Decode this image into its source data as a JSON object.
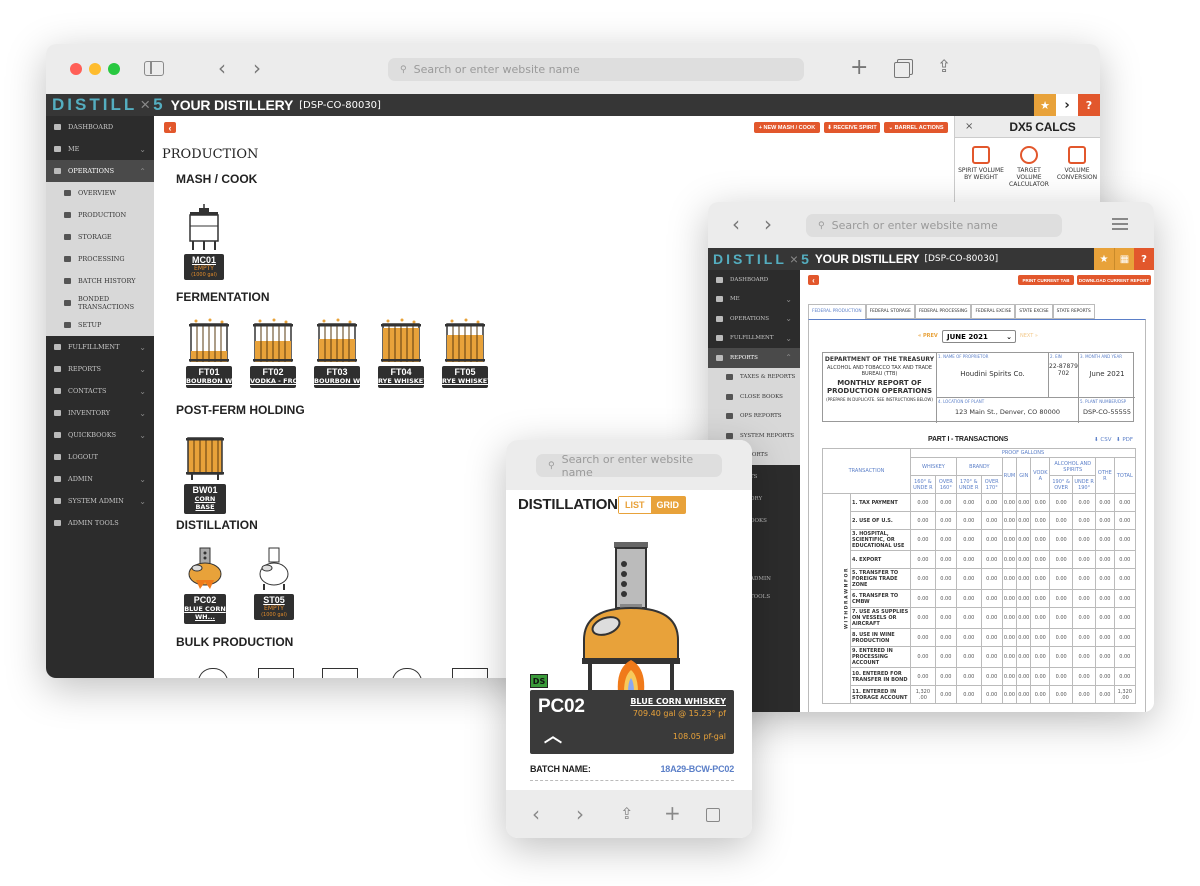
{
  "desktop": {
    "url_placeholder": "Search or enter website name",
    "brand": {
      "logo_left": "DISTILL",
      "logo_x": "×",
      "logo_right": "5",
      "title": "YOUR DISTILLERY",
      "dsp": "[DSP-CO-80030]"
    },
    "sidebar": [
      {
        "label": "DASHBOARD",
        "icon": "dashboard-icon"
      },
      {
        "label": "ME",
        "icon": "user-icon",
        "chev": "⌄"
      },
      {
        "label": "OPERATIONS",
        "icon": "factory-icon",
        "chev": "⌃",
        "active": true
      },
      {
        "label": "OVERVIEW",
        "icon": "binoculars-icon",
        "sub": true
      },
      {
        "label": "PRODUCTION",
        "icon": "production-icon",
        "sub": true
      },
      {
        "label": "STORAGE",
        "icon": "storage-icon",
        "sub": true
      },
      {
        "label": "PROCESSING",
        "icon": "processing-icon",
        "sub": true
      },
      {
        "label": "BATCH HISTORY",
        "icon": "history-icon",
        "sub": true
      },
      {
        "label": "BONDED TRANSACTIONS",
        "icon": "transfer-icon",
        "sub": true
      },
      {
        "label": "SETUP",
        "icon": "wrench-icon",
        "sub": true
      },
      {
        "label": "FULFILLMENT",
        "icon": "fulfillment-icon",
        "chev": "⌄"
      },
      {
        "label": "REPORTS",
        "icon": "chart-icon",
        "chev": "⌄"
      },
      {
        "label": "CONTACTS",
        "icon": "contacts-icon",
        "chev": "⌄"
      },
      {
        "label": "INVENTORY",
        "icon": "inventory-icon",
        "chev": "⌄"
      },
      {
        "label": "QUICKBOOKS",
        "icon": "quickbooks-icon",
        "chev": "⌄"
      },
      {
        "label": "LOGOUT",
        "icon": "logout-icon"
      },
      {
        "label": "ADMIN",
        "icon": "key-icon",
        "chev": "⌄"
      },
      {
        "label": "SYSTEM ADMIN",
        "icon": "filter-icon",
        "chev": "⌄"
      },
      {
        "label": "ADMIN TOOLS",
        "icon": "admin-user-icon"
      }
    ],
    "toolbar": {
      "new_mash": "+ NEW MASH / COOK",
      "receive": "⬇ RECEIVE SPIRIT",
      "barrel": "⌄ BARREL ACTIONS"
    },
    "page_title": "PRODUCTION",
    "sections": {
      "mash": "MASH / COOK",
      "ferm": "FERMENTATION",
      "postferm": "POST-FERM HOLDING",
      "distill": "DISTILLATION",
      "bulk": "BULK PRODUCTION"
    },
    "mash": [
      {
        "code": "MC01",
        "status": "EMPTY",
        "cap": "(1000 gal)"
      }
    ],
    "ferm": [
      {
        "code": "FT01",
        "name": "BOURBON WHI..."
      },
      {
        "code": "FT02",
        "name": "VODKA - FROM ..."
      },
      {
        "code": "FT03",
        "name": "BOURBON WHI..."
      },
      {
        "code": "FT04",
        "name": "RYE WHISKEY"
      },
      {
        "code": "FT05",
        "name": "RYE WHISKEY"
      }
    ],
    "postferm": [
      {
        "code": "BW01",
        "name": "CORN BASE"
      }
    ],
    "distill": [
      {
        "code": "PC02",
        "name": "BLUE CORN WH..."
      },
      {
        "code": "ST05",
        "status": "EMPTY",
        "cap": "(1000 gal)"
      }
    ],
    "calcs": {
      "title": "DX5 CALCS",
      "close": "×",
      "items": [
        "SPIRIT VOLUME BY WEIGHT",
        "TARGET VOLUME CALCULATOR",
        "VOLUME CONVERSION"
      ]
    }
  },
  "tablet": {
    "url_placeholder": "Search or enter website name",
    "brand": {
      "logo_left": "DISTILL",
      "logo_x": "×",
      "logo_right": "5",
      "title": "YOUR DISTILLERY",
      "dsp": "[DSP-CO-80030]"
    },
    "sidebar": [
      {
        "label": "DASHBOARD",
        "icon": "dashboard-icon"
      },
      {
        "label": "ME",
        "icon": "user-icon",
        "chev": "⌄"
      },
      {
        "label": "OPERATIONS",
        "icon": "factory-icon",
        "chev": "⌄"
      },
      {
        "label": "FULFILLMENT",
        "icon": "fulfillment-icon",
        "chev": "⌄"
      },
      {
        "label": "REPORTS",
        "icon": "chart-icon",
        "chev": "⌃",
        "active": true
      },
      {
        "label": "TAXES & REPORTS",
        "icon": "shield-icon",
        "sub": true
      },
      {
        "label": "CLOSE BOOKS",
        "icon": "book-icon",
        "sub": true
      },
      {
        "label": "OPS REPORTS",
        "icon": "report-icon",
        "sub": true
      },
      {
        "label": "SYSTEM REPORTS",
        "icon": "report-icon",
        "sub": true
      },
      {
        "label": "REPORTS",
        "icon": "report-icon",
        "sub": true
      }
    ],
    "buttons": {
      "print": "PRINT CURRENT TAB",
      "download": "DOWNLOAD CURRENT REPORT"
    },
    "tabs": [
      "FEDERAL PRODUCTION",
      "FEDERAL STORAGE",
      "FEDERAL PROCESSING",
      "FEDERAL EXCISE",
      "STATE EXCISE",
      "STATE REPORTS"
    ],
    "period": {
      "prev": "« PREV",
      "month": "JUNE 2021",
      "next": "NEXT »"
    },
    "header": {
      "dept": "DEPARTMENT OF THE TREASURY",
      "bureau": "ALCOHOL AND TOBACCO TAX AND TRADE BUREAU (TTB)",
      "report": "MONTHLY REPORT OF PRODUCTION OPERATIONS",
      "note": "(PREPARE IN DUPLICATE. SEE INSTRUCTIONS BELOW)",
      "name_lbl": "1. NAME OF PROPRIETOR",
      "name": "Houdini Spirits Co.",
      "ein_lbl": "2. EIN",
      "ein": "22-87879 702",
      "month_lbl": "3. MONTH AND YEAR",
      "month": "June 2021",
      "loc_lbl": "4. LOCATION OF PLANT",
      "loc": "123 Main St., Denver, CO 80000",
      "plant_lbl": "5. PLANT NUMBER/DSP",
      "plant": "DSP-CO-55555"
    },
    "part": "PART I - TRANSACTIONS",
    "csv": "⬇ CSV",
    "pdf": "⬇ PDF",
    "cols": {
      "proof": "PROOF GALLONS",
      "trans": "TRANSACTION",
      "whiskey": "WHISKEY",
      "brandy": "BRANDY",
      "rum": "RUM",
      "gin": "GIN",
      "vodka": "VODK A",
      "alcohol": "ALCOHOL AND SPIRITS",
      "other": "OTHE R",
      "total": "TOTAL",
      "w1": "160° & UNDE R",
      "w2": "OVER 160°",
      "b1": "170° & UNDE R",
      "b2": "OVER 170°",
      "a1": "190° & OVER",
      "a2": "UNDE R 190°"
    },
    "side_label": "W I T H D R A W N   F O R",
    "rows": [
      {
        "label": "1. TAX PAYMENT",
        "vals": [
          "0.00",
          "0.00",
          "0.00",
          "0.00",
          "0.00",
          "0.00",
          "0.00",
          "0.00",
          "0.00",
          "0.00",
          "0.00"
        ]
      },
      {
        "label": "2. USE OF U.S.",
        "vals": [
          "0.00",
          "0.00",
          "0.00",
          "0.00",
          "0.00",
          "0.00",
          "0.00",
          "0.00",
          "0.00",
          "0.00",
          "0.00"
        ]
      },
      {
        "label": "3. HOSPITAL, SCIENTIFIC, OR EDUCATIONAL USE",
        "vals": [
          "0.00",
          "0.00",
          "0.00",
          "0.00",
          "0.00",
          "0.00",
          "0.00",
          "0.00",
          "0.00",
          "0.00",
          "0.00"
        ]
      },
      {
        "label": "4. EXPORT",
        "vals": [
          "0.00",
          "0.00",
          "0.00",
          "0.00",
          "0.00",
          "0.00",
          "0.00",
          "0.00",
          "0.00",
          "0.00",
          "0.00"
        ]
      },
      {
        "label": "5. TRANSFER TO FOREIGN TRADE ZONE",
        "vals": [
          "0.00",
          "0.00",
          "0.00",
          "0.00",
          "0.00",
          "0.00",
          "0.00",
          "0.00",
          "0.00",
          "0.00",
          "0.00"
        ]
      },
      {
        "label": "6. TRANSFER TO CMBW",
        "vals": [
          "0.00",
          "0.00",
          "0.00",
          "0.00",
          "0.00",
          "0.00",
          "0.00",
          "0.00",
          "0.00",
          "0.00",
          "0.00"
        ]
      },
      {
        "label": "7. USE AS SUPPLIES ON VESSELS OR AIRCRAFT",
        "vals": [
          "0.00",
          "0.00",
          "0.00",
          "0.00",
          "0.00",
          "0.00",
          "0.00",
          "0.00",
          "0.00",
          "0.00",
          "0.00"
        ]
      },
      {
        "label": "8. USE IN WINE PRODUCTION",
        "vals": [
          "0.00",
          "0.00",
          "0.00",
          "0.00",
          "0.00",
          "0.00",
          "0.00",
          "0.00",
          "0.00",
          "0.00",
          "0.00"
        ]
      },
      {
        "label": "9. ENTERED IN PROCESSING ACCOUNT",
        "vals": [
          "0.00",
          "0.00",
          "0.00",
          "0.00",
          "0.00",
          "0.00",
          "0.00",
          "0.00",
          "0.00",
          "0.00",
          "0.00"
        ]
      },
      {
        "label": "10. ENTERED FOR TRANSFER IN BOND",
        "vals": [
          "0.00",
          "0.00",
          "0.00",
          "0.00",
          "0.00",
          "0.00",
          "0.00",
          "0.00",
          "0.00",
          "0.00",
          "0.00"
        ]
      },
      {
        "label": "11. ENTERED IN STORAGE ACCOUNT",
        "vals": [
          "1,320 .00",
          "0.00",
          "0.00",
          "0.00",
          "0.00",
          "0.00",
          "0.00",
          "0.00",
          "0.00",
          "0.00",
          "1,320 .00"
        ]
      }
    ],
    "extra_side": [
      "TS",
      "ORY",
      "OOKS",
      "ADMIN",
      "TOOLS"
    ]
  },
  "phone": {
    "url_placeholder": "Search or enter website name",
    "title": "DISTILLATION",
    "toggle": {
      "list": "LIST",
      "grid": "GRID"
    },
    "badge": "DS",
    "vessel": {
      "code": "PC02",
      "name": "BLUE CORN WHISKEY",
      "volume": "709.40 gal @ 15.23° pf",
      "pfgal": "108.05 pf-gal"
    },
    "batch_label": "BATCH NAME:",
    "batch": "18A29-BCW-PC02"
  },
  "colors": {
    "accent": "#e2572c",
    "brand_teal": "#54aec0",
    "tank_orange": "#e8a23a",
    "dark": "#2f2f2f",
    "star": "#e8a23a"
  }
}
